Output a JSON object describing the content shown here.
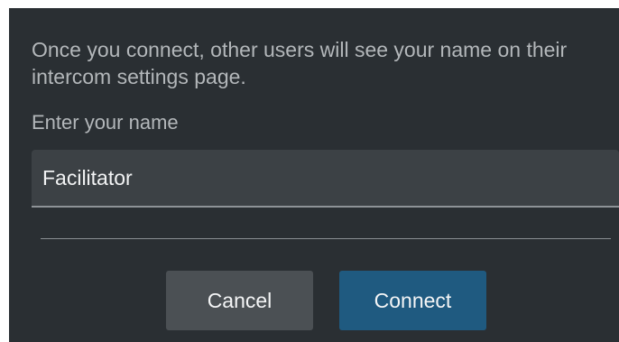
{
  "dialog": {
    "description": "Once you connect, other users will see your name on their intercom settings page.",
    "name_label": "Enter your name",
    "name_value": "Facilitator",
    "buttons": {
      "cancel_label": "Cancel",
      "connect_label": "Connect"
    }
  },
  "colors": {
    "dialog_background": "#2a2f33",
    "input_background": "#3c4145",
    "cancel_button": "#4b5054",
    "connect_button": "#1f5a80",
    "secondary_text": "#b3b7ba",
    "primary_text": "#f2f3f4"
  }
}
